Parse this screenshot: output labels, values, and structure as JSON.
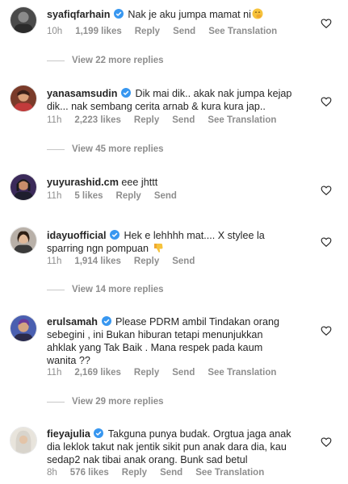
{
  "comments": [
    {
      "username": "syafiqfarhain",
      "verified": true,
      "text_lines": [
        "Nak je aku jumpa mamat ni"
      ],
      "emoji": "smiling-face-with-hand-over-mouth",
      "time": "10h",
      "likes": "1,199 likes",
      "reply": "Reply",
      "send": "Send",
      "translation": "See Translation",
      "view_replies": "View 22 more replies"
    },
    {
      "username": "yanasamsudin",
      "verified": true,
      "text_lines": [
        "Dik mai dik.. akak nak jumpa kejap",
        "dik... nak sembang cerita arnab & kura kura jap.."
      ],
      "time": "11h",
      "likes": "2,223 likes",
      "reply": "Reply",
      "send": "Send",
      "translation": "See Translation",
      "view_replies": "View 45 more replies"
    },
    {
      "username": "yuyurashid.cm",
      "verified": false,
      "text_lines": [
        "eee jhttt"
      ],
      "time": "11h",
      "likes": "5 likes",
      "reply": "Reply",
      "send": "Send"
    },
    {
      "username": "idayuofficial",
      "verified": true,
      "text_lines": [
        "Hek e lehhhh mat.... X stylee la",
        "sparring ngn pompuan"
      ],
      "emoji": "thumbs-down",
      "time": "11h",
      "likes": "1,914 likes",
      "reply": "Reply",
      "send": "Send",
      "view_replies": "View 14 more replies"
    },
    {
      "username": "erulsamah",
      "verified": true,
      "text_lines": [
        "Please PDRM ambil Tindakan orang",
        "sebegini , ini Bukan hiburan tetapi menunjukkan",
        "ahklak yang Tak Baik . Mana respek pada kaum",
        "wanita ??"
      ],
      "time": "11h",
      "likes": "2,169 likes",
      "reply": "Reply",
      "send": "Send",
      "translation": "See Translation",
      "view_replies": "View 29 more replies"
    },
    {
      "username": "fieyajulia",
      "verified": true,
      "text_lines": [
        "Takguna punya budak. Orgtua jaga anak",
        "dia leklok takut nak jentik sikit pun anak dara dia, kau",
        "sedap2 nak tibai anak orang. Bunk sad betul"
      ],
      "time": "8h",
      "likes": "576 likes",
      "reply": "Reply",
      "send": "Send",
      "translation": "See Translation"
    }
  ],
  "colors": {
    "text": "#262626",
    "muted": "#8e8e8e",
    "verified": "#3897f0",
    "divider": "#c7c7c7"
  },
  "icons": {
    "like": "heart-outline-icon",
    "verified": "verified-badge-icon"
  }
}
